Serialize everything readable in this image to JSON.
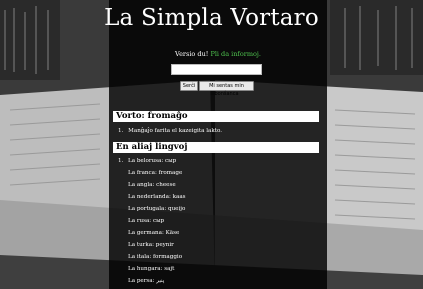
{
  "header": {
    "title": "La Simpla Vortaro",
    "version_text": "Versio du!",
    "more_info_link": "Pli da informoj."
  },
  "search": {
    "value": "",
    "search_button": "Serĉi",
    "random_button": "Mi sentas min bonŝanca"
  },
  "entry": {
    "heading": "Vorto: fromaĝo",
    "definition": "Manĝaĵo farita el kazeigita lakto."
  },
  "translations": {
    "heading": "En aliaj lingvoj",
    "items": [
      "La belorusa: сыр",
      "La franca: fromage",
      "La angla: cheese",
      "La nederlanda: kaas",
      "La portugala: queijo",
      "La rusa: сыр",
      "La germana: Käse",
      "La turka: peynir",
      "La itala: formaggio",
      "La hungara: sajt",
      "La persa: پنیر"
    ]
  }
}
